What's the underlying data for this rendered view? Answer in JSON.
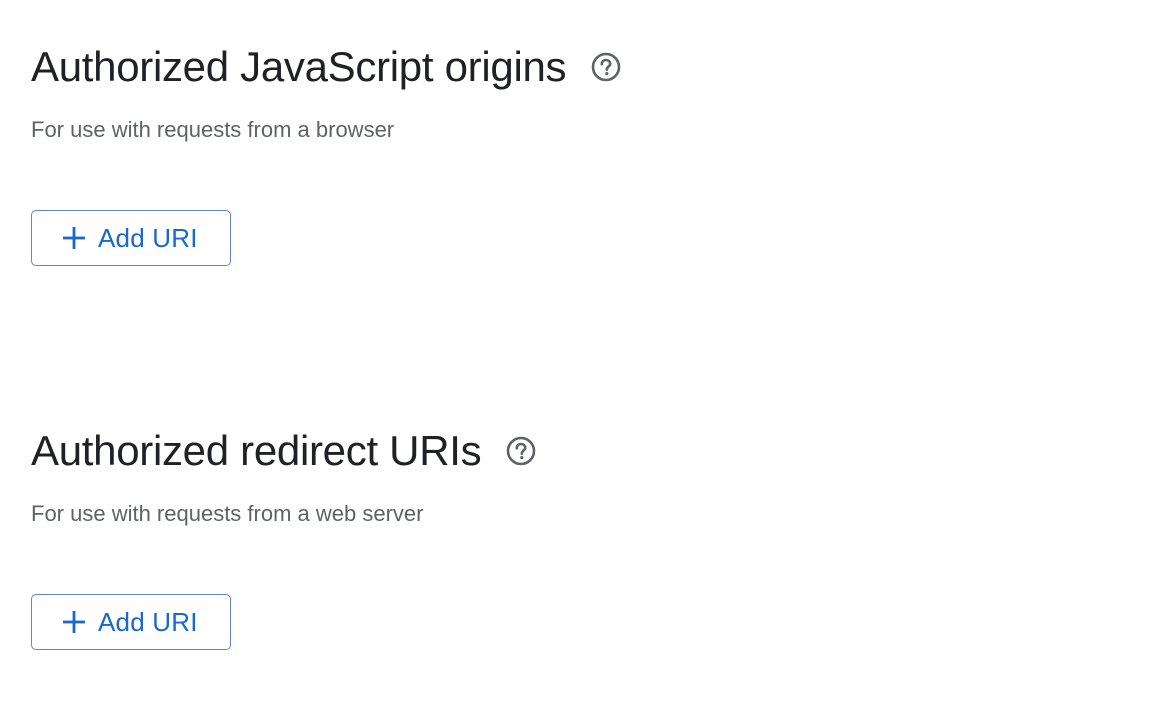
{
  "origins": {
    "title": "Authorized JavaScript origins",
    "help_icon": "help-circle-icon",
    "subtitle": "For use with requests from a browser",
    "add_button": {
      "icon": "plus-icon",
      "label": "Add URI"
    }
  },
  "redirects": {
    "title": "Authorized redirect URIs",
    "help_icon": "help-circle-icon",
    "subtitle": "For use with requests from a web server",
    "add_button": {
      "icon": "plus-icon",
      "label": "Add URI"
    }
  },
  "colors": {
    "heading": "#202124",
    "subtitle": "#5f6368",
    "accent": "#1a66d2",
    "button_border": "#5f86d6",
    "icon": "#5f6368"
  }
}
